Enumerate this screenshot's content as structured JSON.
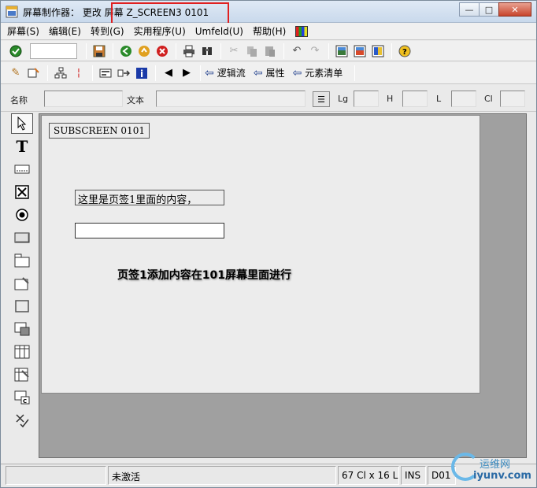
{
  "window": {
    "title": "屏幕制作器： 更改 屏幕 Z_SCREEN3 0101",
    "minimize": "—",
    "maximize": "□",
    "close": "✕"
  },
  "menu": {
    "items": [
      "屏幕(S)",
      "编辑(E)",
      "转到(G)",
      "实用程序(U)",
      "Umfeld(U)",
      "帮助(H)"
    ]
  },
  "toolbar2": {
    "logic_flow": "逻辑流",
    "attributes": "属性",
    "element_list": "元素清单"
  },
  "fields": {
    "name_label": "名称",
    "text_label": "文本",
    "lg_label": "Lg",
    "h_label": "H",
    "l_label": "L",
    "cl_label": "Cl"
  },
  "canvas": {
    "subscreen_label": "SUBSCREEN 0101",
    "text_element": "这里是页签1里面的内容，",
    "annotation": "页签1添加内容在101屏幕里面进行"
  },
  "status": {
    "empty": "",
    "state": "未激活",
    "size": "67 Cl x 16 L",
    "mode": "INS",
    "system": "D01"
  },
  "watermark": {
    "cn": "运维网",
    "en": "iyunv.com"
  }
}
